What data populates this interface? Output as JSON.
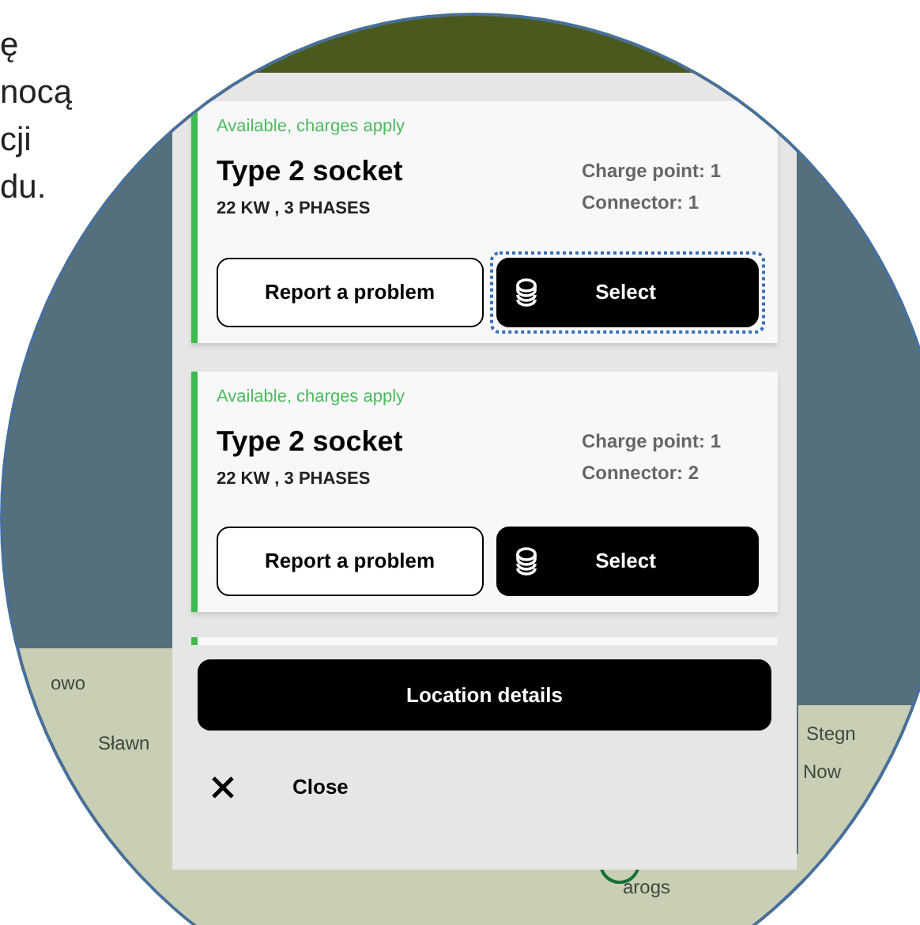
{
  "background_text": [
    "ę",
    "nocą",
    "cji",
    "du."
  ],
  "map_labels": [
    "owo",
    "Sławn",
    "Stegn",
    "Now",
    "arogs"
  ],
  "connectors": [
    {
      "status": "Available, charges apply",
      "title": "Type 2 socket",
      "power": "22 KW , 3 PHASES",
      "charge_point": "Charge point: 1",
      "connector": "Connector: 1",
      "report_button": "Report a problem",
      "select_button": "Select",
      "focused": true
    },
    {
      "status": "Available, charges apply",
      "title": "Type 2 socket",
      "power": "22 KW , 3 PHASES",
      "charge_point": "Charge point: 1",
      "connector": "Connector: 2",
      "report_button": "Report a problem",
      "select_button": "Select",
      "focused": false
    }
  ],
  "location_button": "Location details",
  "close_button": "Close"
}
